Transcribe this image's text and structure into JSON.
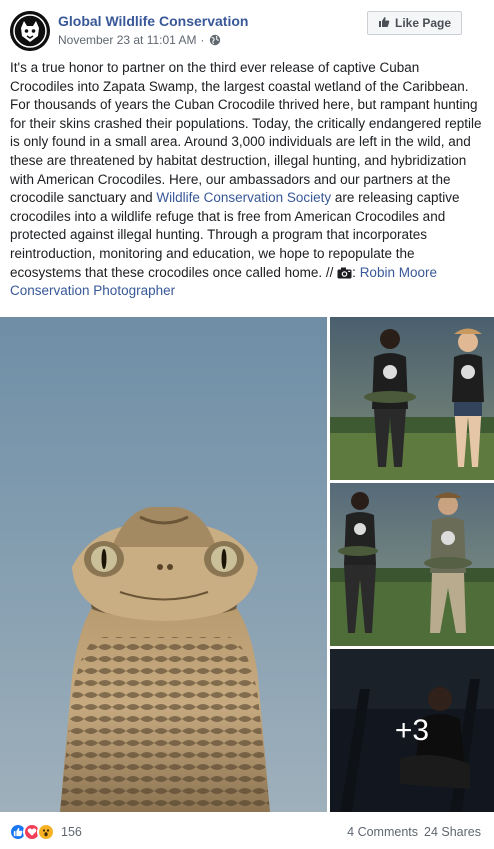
{
  "header": {
    "page_name": "Global Wildlife Conservation",
    "timestamp": "November 23 at 11:01 AM",
    "separator": "·",
    "privacy_icon": "globe-icon",
    "like_page_label": "Like Page"
  },
  "post": {
    "text_main": "It's a true honor to partner on the third ever release of captive Cuban Crocodiles into Zapata Swamp, the largest coastal wetland of the Caribbean. For thousands of years the Cuban Crocodile thrived here, but rampant hunting for their skins crashed their populations. Today, the critically endangered reptile is only found in a small area. Around 3,000 individuals are left in the wild, and these are threatened by habitat destruction, illegal hunting, and hybridization with American Crocodiles. Here, our ambassadors and our partners at the crocodile sanctuary and ",
    "link_wcs": "Wildlife Conservation Society",
    "text_after_link": " are releasing captive crocodiles into a wildlife refuge that is free from American Crocodiles and protected against illegal hunting. Through a program that incorporates reintroduction, monitoring and education, we hope to repopulate the ecosystems that these crocodiles once called home. // ",
    "camera_icon": "camera-icon",
    "credit_label": ": ",
    "link_photographer": "Robin Moore Conservation Photographer"
  },
  "media": {
    "more_count": "+3"
  },
  "footer": {
    "reaction_icons": [
      "like-icon",
      "love-icon",
      "wow-icon"
    ],
    "reaction_count": "156",
    "comments": "4 Comments",
    "shares": "24 Shares"
  },
  "colors": {
    "link": "#385898",
    "like_blue": "#1877f2",
    "love_red": "#f33e58",
    "wow_yellow": "#f7b125"
  }
}
